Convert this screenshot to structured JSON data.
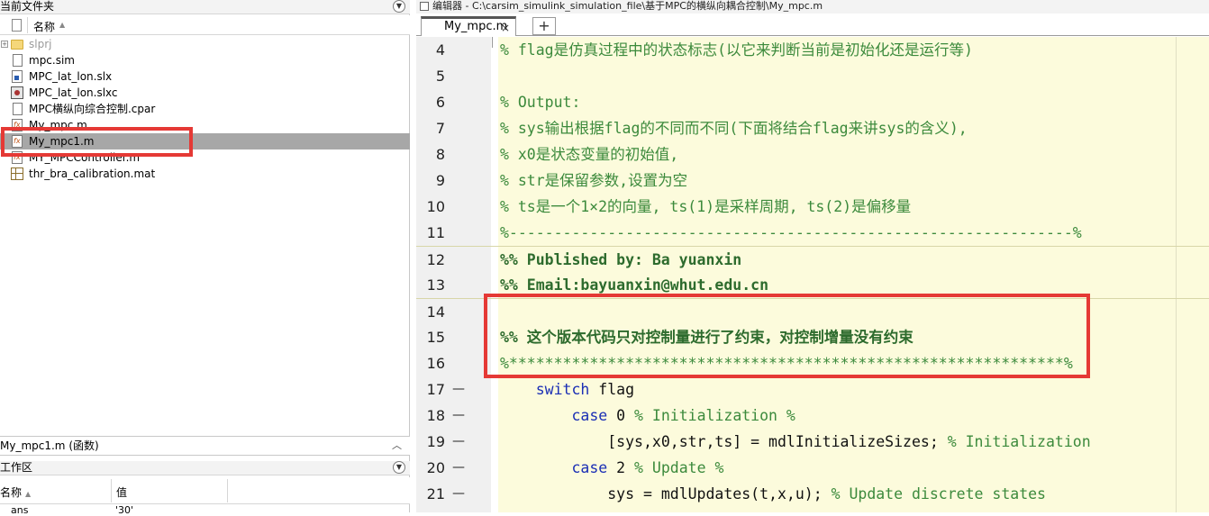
{
  "file_browser": {
    "title": "当前文件夹",
    "column_name": "名称",
    "files": [
      {
        "name": "slprj",
        "icon": "folder-icon",
        "type": "folder",
        "expandable": true,
        "dim": true
      },
      {
        "name": "mpc.sim",
        "icon": "document-icon",
        "type": "file"
      },
      {
        "name": "MPC_lat_lon.slx",
        "icon": "simulink-model-icon",
        "type": "file"
      },
      {
        "name": "MPC_lat_lon.slxc",
        "icon": "simulink-cache-icon",
        "type": "file"
      },
      {
        "name": "MPC横纵向综合控制.cpar",
        "icon": "document-icon",
        "type": "file"
      },
      {
        "name": "My_mpc.m",
        "icon": "m-file-icon",
        "type": "file"
      },
      {
        "name": "My_mpc1.m",
        "icon": "m-file-icon",
        "type": "file",
        "selected": true
      },
      {
        "name": "MY_MPCController.m",
        "icon": "m-file-icon",
        "type": "file"
      },
      {
        "name": "thr_bra_calibration.mat",
        "icon": "mat-file-icon",
        "type": "file"
      }
    ],
    "details_label": "My_mpc1.m (函数)"
  },
  "workspace": {
    "title": "工作区",
    "column_name": "名称",
    "column_value": "值",
    "row": {
      "name": "ans",
      "value": "'30'"
    }
  },
  "editor": {
    "title": "编辑器 - C:\\carsim_simulink_simulation_file\\基于MPC的横纵向耦合控制\\My_mpc.m",
    "tab_label": "My_mpc.m",
    "tab_close": "×",
    "tab_add": "+",
    "lines": [
      {
        "num": "4",
        "dash": "",
        "style": "comment",
        "text": "% flag是仿真过程中的状态标志(以它来判断当前是初始化还是运行等)"
      },
      {
        "num": "5",
        "dash": "",
        "style": "text",
        "text": ""
      },
      {
        "num": "6",
        "dash": "",
        "style": "comment",
        "text": "% Output:"
      },
      {
        "num": "7",
        "dash": "",
        "style": "comment",
        "text": "% sys输出根据flag的不同而不同(下面将结合flag来讲sys的含义),"
      },
      {
        "num": "8",
        "dash": "",
        "style": "comment",
        "text": "% x0是状态变量的初始值,"
      },
      {
        "num": "9",
        "dash": "",
        "style": "comment",
        "text": "% str是保留参数,设置为空"
      },
      {
        "num": "10",
        "dash": "",
        "style": "comment",
        "text": "% ts是一个1×2的向量, ts(1)是采样周期, ts(2)是偏移量"
      },
      {
        "num": "11",
        "dash": "",
        "style": "comment",
        "text": "%---------------------------------------------------------------%"
      },
      {
        "num": "12",
        "dash": "",
        "style": "cell",
        "text": "%% Published by: Ba yuanxin"
      },
      {
        "num": "13",
        "dash": "",
        "style": "cell",
        "text": "%% Email:bayuanxin@whut.edu.cn"
      },
      {
        "num": "14",
        "dash": "",
        "style": "cell-empty",
        "text": ""
      },
      {
        "num": "15",
        "dash": "",
        "style": "cell",
        "text": "%% 这个版本代码只对控制量进行了约束，对控制增量没有约束"
      },
      {
        "num": "16",
        "dash": "",
        "style": "comment",
        "text": "%**************************************************************%"
      },
      {
        "num": "17",
        "dash": "—",
        "style": "mixed",
        "indent": "    ",
        "kw": "switch",
        "rest": " flag",
        "comment": ""
      },
      {
        "num": "18",
        "dash": "—",
        "style": "mixed",
        "indent": "        ",
        "kw": "case",
        "rest": " 0 ",
        "comment": "% Initialization %"
      },
      {
        "num": "19",
        "dash": "—",
        "style": "mixed",
        "indent": "            ",
        "kw": "",
        "rest": "[sys,x0,str,ts] = mdlInitializeSizes; ",
        "comment": "% Initialization"
      },
      {
        "num": "20",
        "dash": "—",
        "style": "mixed",
        "indent": "        ",
        "kw": "case",
        "rest": " 2 ",
        "comment": "% Update %"
      },
      {
        "num": "21",
        "dash": "—",
        "style": "mixed",
        "indent": "            ",
        "kw": "",
        "rest": "sys = mdlUpdates(t,x,u); ",
        "comment": "% Update discrete states"
      }
    ]
  }
}
